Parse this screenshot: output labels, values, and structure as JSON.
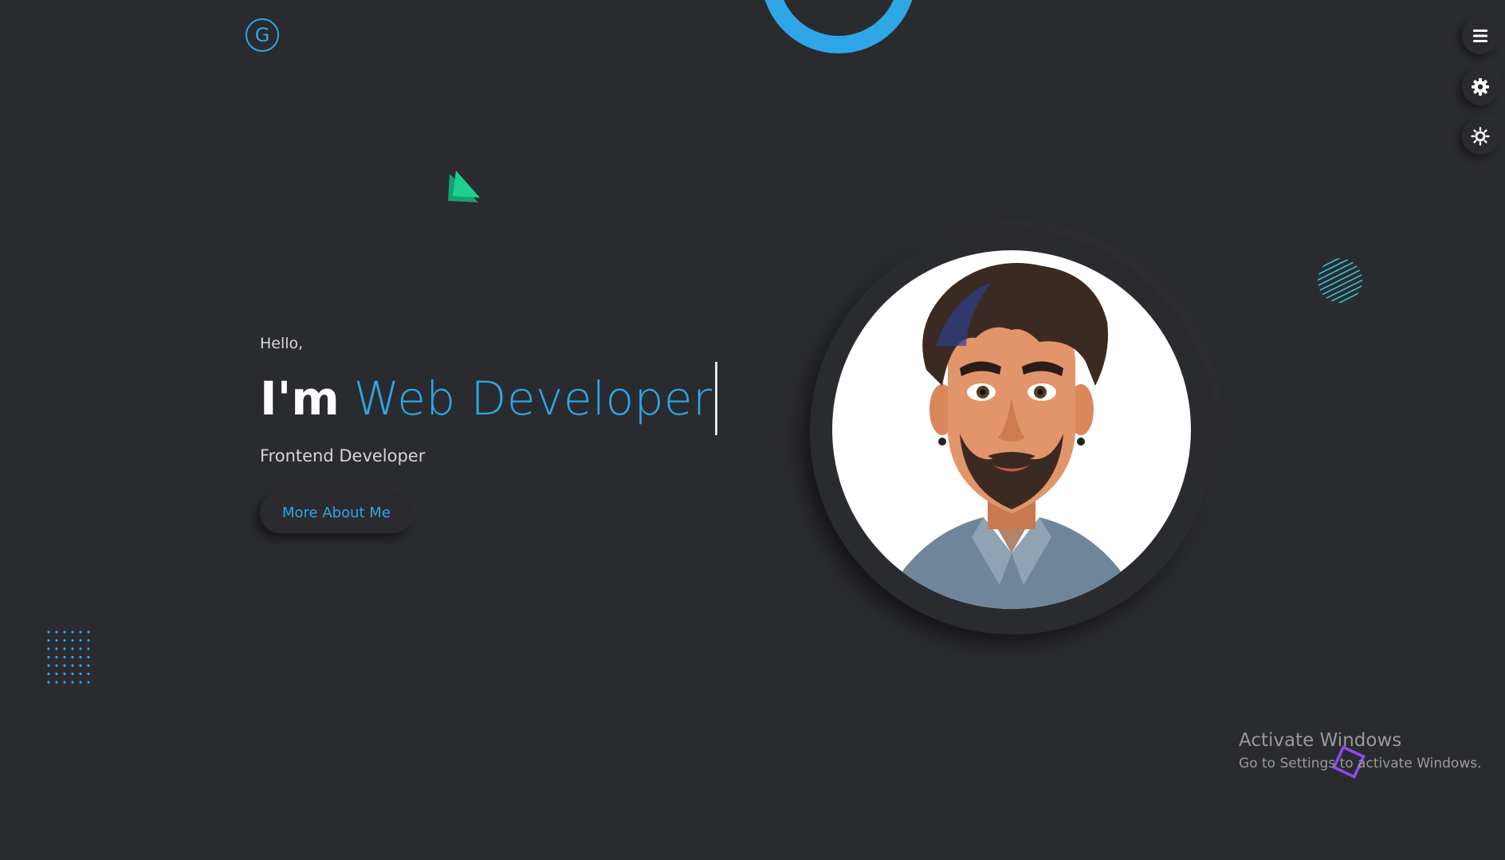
{
  "logo": {
    "letter": "G"
  },
  "hero": {
    "greeting": "Hello,",
    "lead": "I'm",
    "role": "Web Developer",
    "subtitle": "Frontend Developer",
    "cta_label": "More About Me"
  },
  "side_controls": {
    "icons": [
      "menu-icon",
      "gear-icon",
      "theme-toggle-icon"
    ]
  },
  "watermark": {
    "title": "Activate Windows",
    "subtitle": "Go to Settings to activate Windows."
  },
  "colors": {
    "background": "#2a2b2f",
    "accent": "#2fa6e6",
    "triangle": "#1fcf8f",
    "square": "#8a4cf0"
  }
}
